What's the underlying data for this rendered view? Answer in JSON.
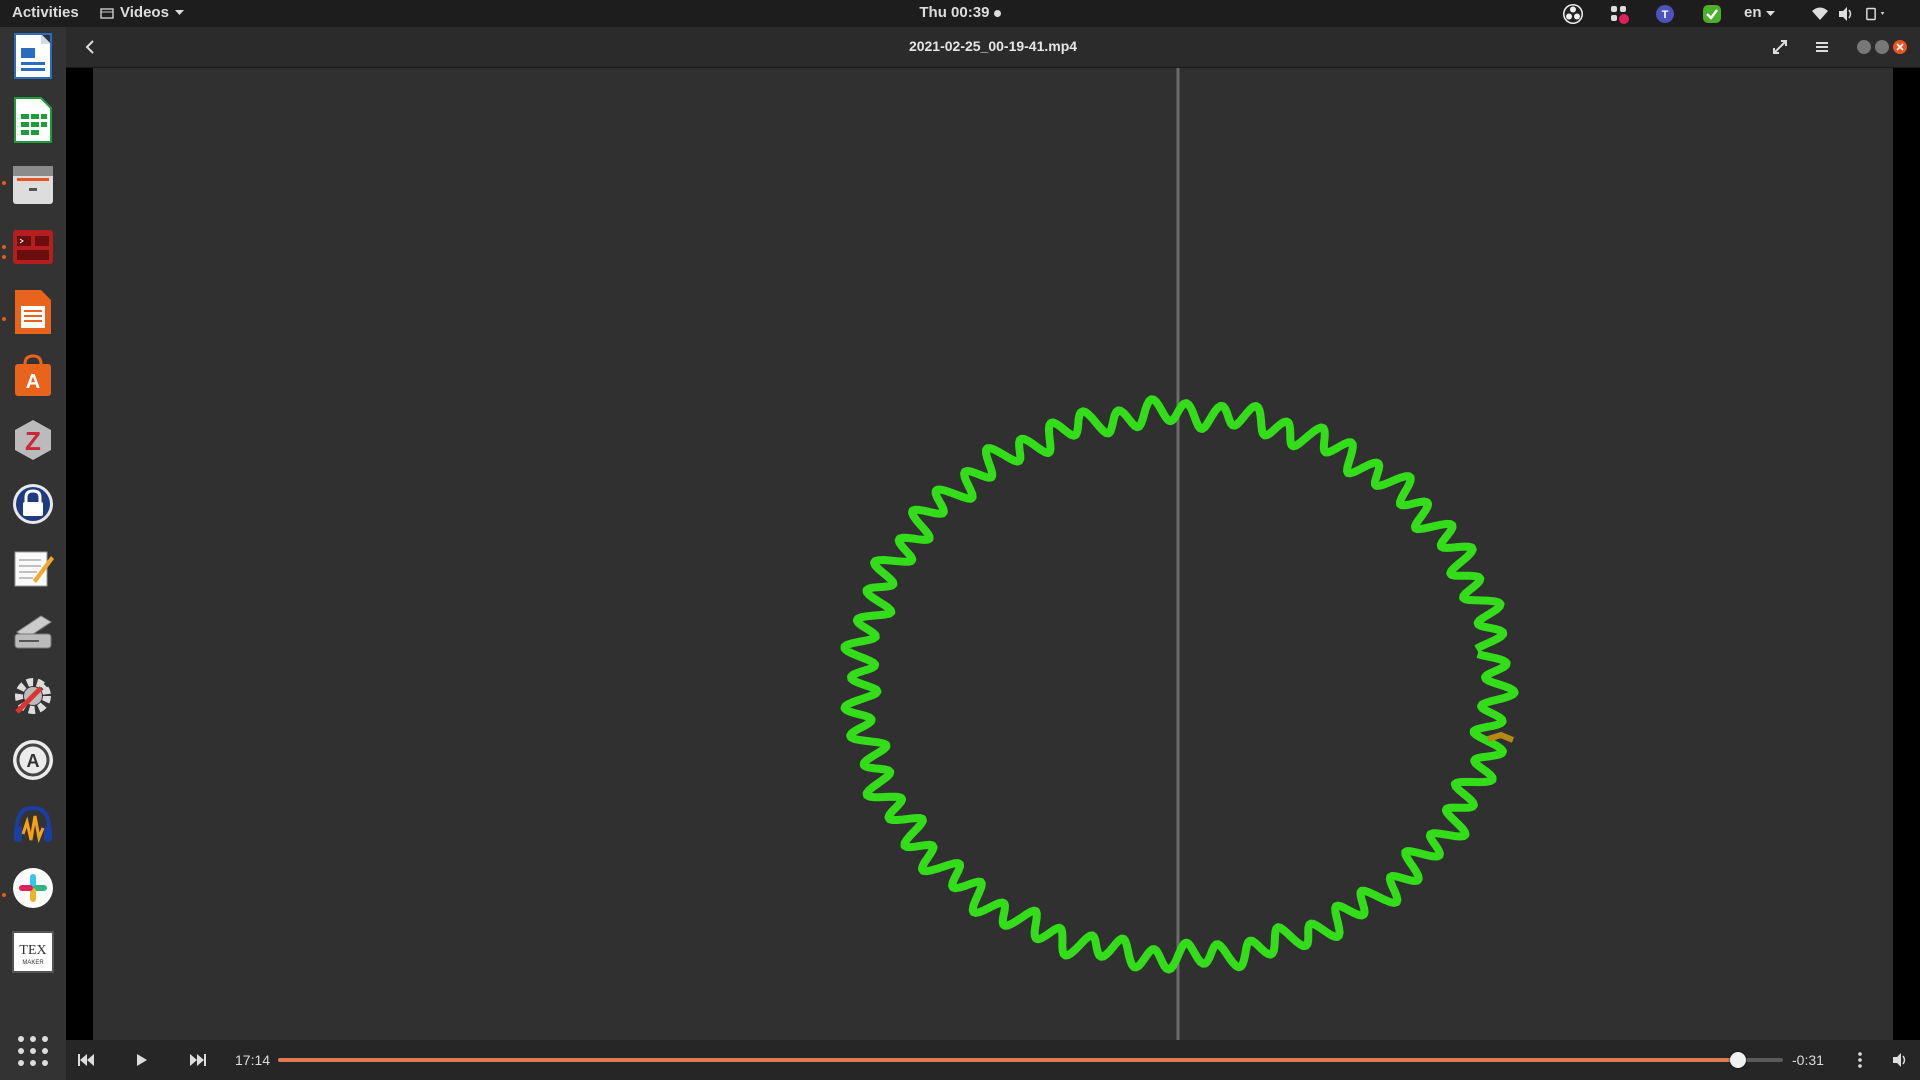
{
  "topbar": {
    "activities": "Activities",
    "app_menu": "Videos",
    "clock": "Thu 00:39",
    "language": "en",
    "tray_icons": [
      "obs-icon",
      "slack-tray-icon",
      "teams-icon",
      "check-icon",
      "wifi-icon",
      "volume-icon",
      "power-icon"
    ]
  },
  "dock": {
    "items": [
      "libreoffice-writer",
      "libreoffice-calc",
      "file-manager",
      "terminal",
      "document-viewer",
      "software-center",
      "zotero",
      "keepass",
      "text-editor",
      "scanner",
      "settings",
      "software-updater",
      "audacity",
      "slack",
      "texmaker",
      "show-applications"
    ]
  },
  "window": {
    "title": "2021-02-25_00-19-41.mp4"
  },
  "controls": {
    "elapsed": "17:14",
    "remaining": "-0:31",
    "progress_fraction": 0.97
  },
  "colors": {
    "accent": "#e07a4f",
    "trace": "#33dd1a",
    "video_bg": "#303030"
  }
}
